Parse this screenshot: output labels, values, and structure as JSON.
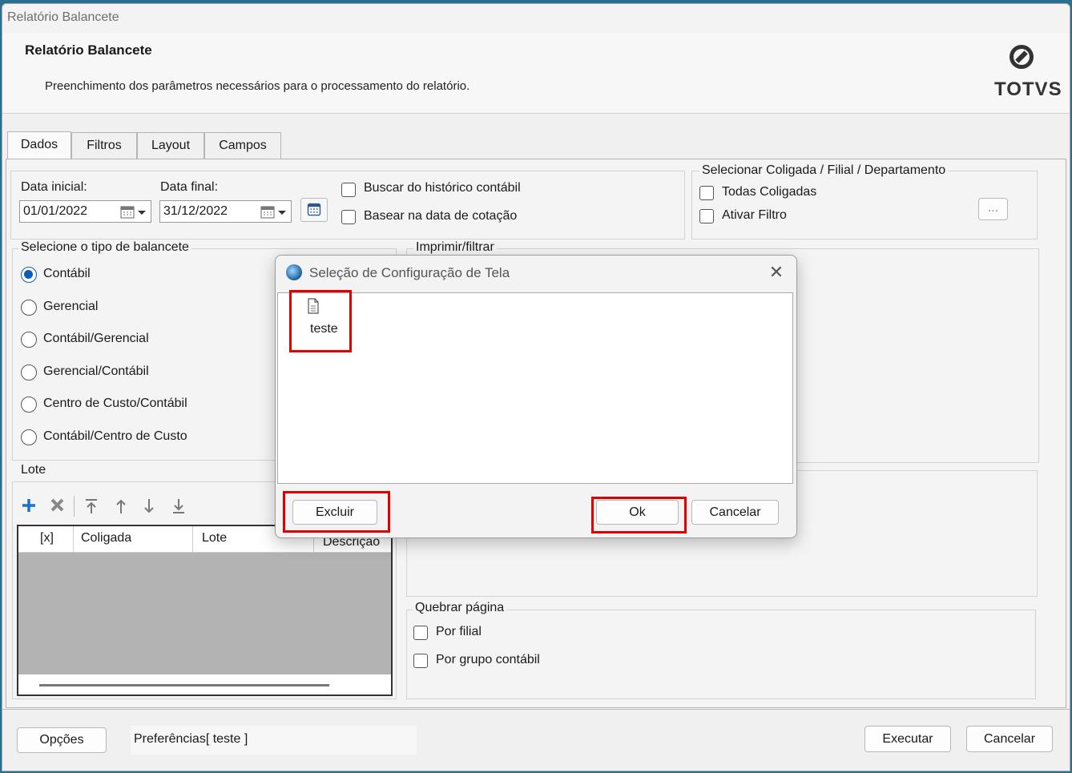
{
  "window": {
    "title": "Relatório Balancete"
  },
  "header": {
    "title": "Relatório Balancete",
    "description": "Preenchimento dos parâmetros necessários para o processamento do relatório.",
    "logo_text": "TOTVS"
  },
  "tabs": [
    {
      "label": "Dados",
      "active": true
    },
    {
      "label": "Filtros",
      "active": false
    },
    {
      "label": "Layout",
      "active": false
    },
    {
      "label": "Campos",
      "active": false
    }
  ],
  "dates": {
    "start_label": "Data inicial:",
    "start_value": "01/01/2022",
    "end_label": "Data final:",
    "end_value": "31/12/2022"
  },
  "options": {
    "buscar_historico": {
      "label": "Buscar do histórico contábil",
      "checked": false
    },
    "basear_cotacao": {
      "label": "Basear na data de cotação",
      "checked": false
    }
  },
  "coligada_group": {
    "label": "Selecionar Coligada / Filial / Departamento",
    "todas": {
      "label": "Todas Coligadas",
      "checked": false
    },
    "ativar_filtro": {
      "label": "Ativar Filtro",
      "checked": false
    },
    "browse_label": "..."
  },
  "balancete_type": {
    "label": "Selecione o tipo de balancete",
    "selected": "Contábil",
    "items": [
      "Contábil",
      "Gerencial",
      "Contábil/Gerencial",
      "Gerencial/Contábil",
      "Centro de Custo/Contábil",
      "Contábil/Centro de Custo"
    ]
  },
  "imprimir_group": {
    "label": "Imprimir/filtrar"
  },
  "lote": {
    "label": "Lote",
    "toolbar_icons": [
      "add-icon",
      "delete-icon",
      "move-top-icon",
      "move-up-icon",
      "move-down-icon",
      "move-bottom-icon"
    ],
    "columns": [
      "[x]",
      "Coligada",
      "Lote",
      "Descrição"
    ]
  },
  "quebrar_pagina": {
    "label": "Quebrar página",
    "por_filial": {
      "label": "Por filial",
      "checked": false
    },
    "por_grupo": {
      "label": "Por grupo contábil",
      "checked": false
    }
  },
  "footer": {
    "options_label": "Opções",
    "preferences_text": "Preferências[ teste ]",
    "run_label": "Executar",
    "cancel_label": "Cancelar"
  },
  "dialog": {
    "title": "Seleção de Configuração de Tela",
    "items": [
      {
        "name": "teste",
        "icon": "document-icon"
      }
    ],
    "delete_label": "Excluir",
    "ok_label": "Ok",
    "cancel_label": "Cancelar"
  },
  "colors": {
    "accent": "#0a5fb4",
    "highlight": "#e00000",
    "grid_empty": "#b3b3b3",
    "toolbar_add": "#1a73c9"
  }
}
